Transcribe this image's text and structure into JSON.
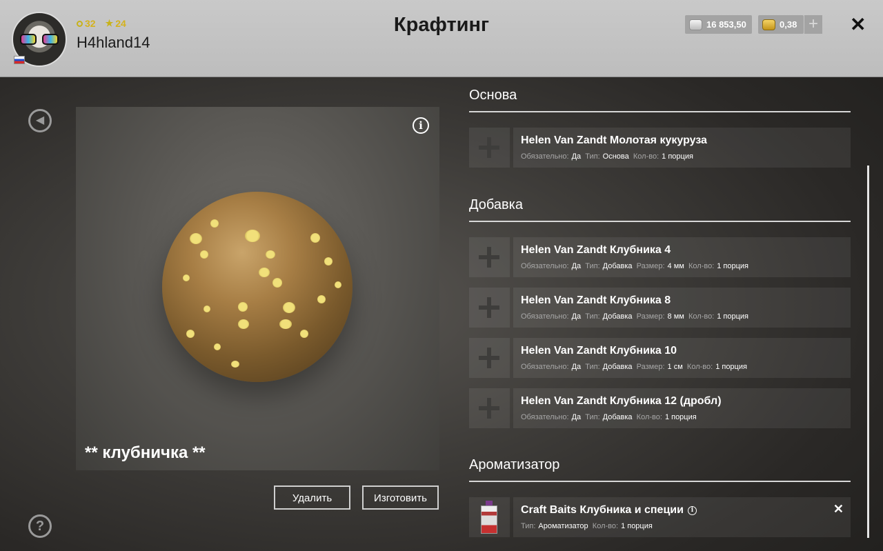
{
  "header": {
    "title": "Крафтинг",
    "player": {
      "name": "H4hland14",
      "stat_ring": "32",
      "stat_star": "24"
    },
    "currency": {
      "silver": "16 853,50",
      "gold": "0,38",
      "add_symbol": "+"
    },
    "close_symbol": "✕"
  },
  "preview": {
    "recipe_name": "** клубничка **",
    "info_symbol": "i"
  },
  "actions": {
    "delete_label": "Удалить",
    "make_label": "Изготовить"
  },
  "help_symbol": "?",
  "sections": {
    "base": {
      "title": "Основа",
      "items": [
        {
          "name": "Helen Van Zandt Молотая кукуруза",
          "req_label": "Обязательно:",
          "req": "Да",
          "type_label": "Тип:",
          "type": "Основа",
          "qty_label": "Кол-во:",
          "qty": "1 порция"
        }
      ]
    },
    "additive": {
      "title": "Добавка",
      "items": [
        {
          "name": "Helen Van Zandt Клубника 4",
          "req_label": "Обязательно:",
          "req": "Да",
          "type_label": "Тип:",
          "type": "Добавка",
          "size_label": "Размер:",
          "size": "4 мм",
          "qty_label": "Кол-во:",
          "qty": "1 порция"
        },
        {
          "name": "Helen Van Zandt Клубника 8",
          "req_label": "Обязательно:",
          "req": "Да",
          "type_label": "Тип:",
          "type": "Добавка",
          "size_label": "Размер:",
          "size": "8 мм",
          "qty_label": "Кол-во:",
          "qty": "1 порция"
        },
        {
          "name": "Helen Van Zandt Клубника 10",
          "req_label": "Обязательно:",
          "req": "Да",
          "type_label": "Тип:",
          "type": "Добавка",
          "size_label": "Размер:",
          "size": "1 см",
          "qty_label": "Кол-во:",
          "qty": "1 порция"
        },
        {
          "name": "Helen Van Zandt Клубника 12 (дробл)",
          "req_label": "Обязательно:",
          "req": "Да",
          "type_label": "Тип:",
          "type": "Добавка",
          "qty_label": "Кол-во:",
          "qty": "1 порция"
        }
      ]
    },
    "flavor": {
      "title": "Ароматизатор",
      "items": [
        {
          "name": "Craft Baits Клубника и специи",
          "type_label": "Тип:",
          "type": "Ароматизатор",
          "qty_label": "Кол-во:",
          "qty": "1 порция",
          "remove_symbol": "✕"
        }
      ]
    }
  },
  "icons": {
    "back": "arrow-left-icon",
    "help": "question-icon",
    "info": "info-icon",
    "plus": "plus-icon",
    "close": "close-icon",
    "silver": "silver-coins-icon",
    "gold": "gold-coins-icon"
  },
  "colors": {
    "header_bg": "#c4c4c4",
    "stat_yellow": "#c7b21a",
    "panel_bg": "#3a3836"
  }
}
